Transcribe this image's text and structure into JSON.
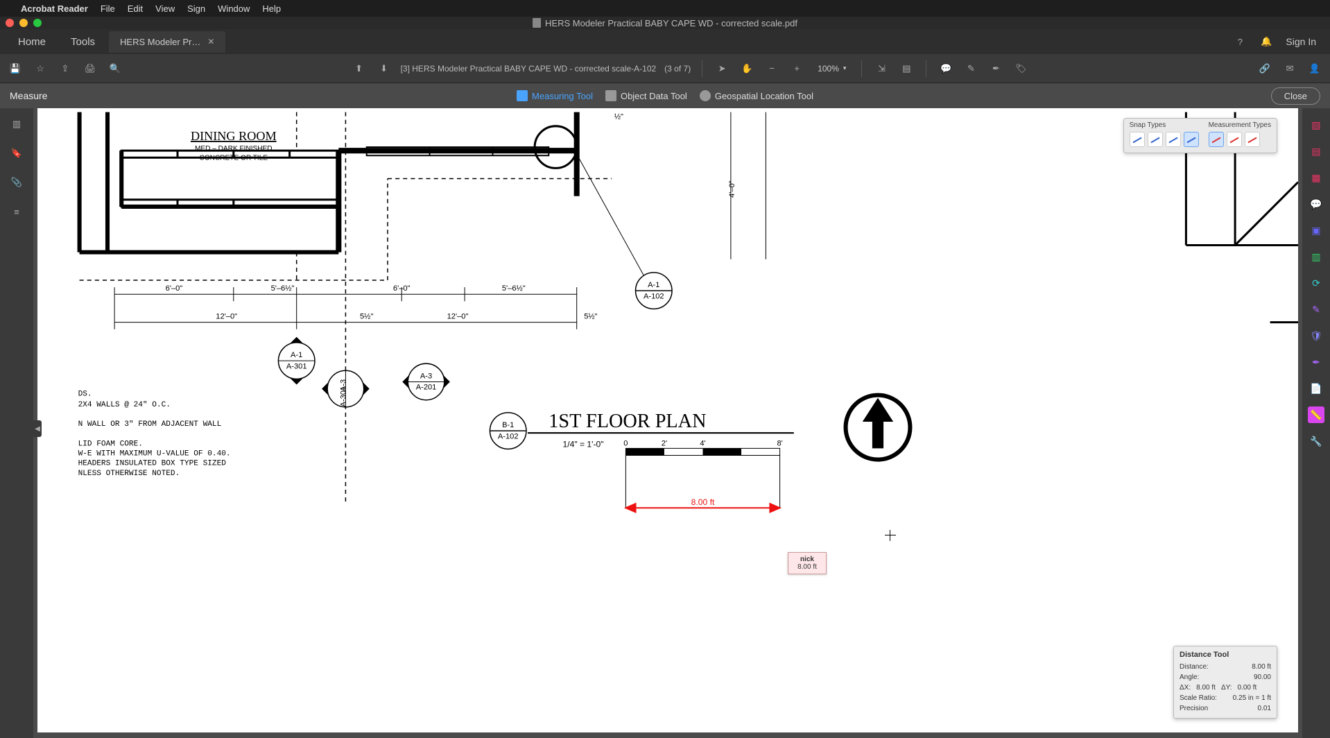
{
  "menubar": {
    "apple": "",
    "app": "Acrobat Reader",
    "items": [
      "File",
      "Edit",
      "View",
      "Sign",
      "Window",
      "Help"
    ]
  },
  "window": {
    "title": "HERS Modeler Practical BABY CAPE WD - corrected scale.pdf"
  },
  "tabs": {
    "home": "Home",
    "tools": "Tools",
    "doc": "HERS Modeler Pr…"
  },
  "tabbar_right": {
    "signin": "Sign In"
  },
  "toolbar": {
    "page_label": "[3] HERS Modeler Practical BABY CAPE WD - corrected scale-A-102",
    "page_of": "(3 of 7)",
    "zoom": "100%"
  },
  "subtoolbar": {
    "label": "Measure",
    "measuring": "Measuring Tool",
    "object": "Object Data Tool",
    "geo": "Geospatial Location Tool",
    "close": "Close"
  },
  "palette": {
    "snap": "Snap Types",
    "meas": "Measurement Types"
  },
  "distance_panel": {
    "title": "Distance Tool",
    "rows": {
      "distance_k": "Distance:",
      "distance_v": "8.00 ft",
      "angle_k": "Angle:",
      "angle_v": "90.00",
      "dx_k": "ΔX:",
      "dx_v": "8.00 ft",
      "dy_k": "ΔY:",
      "dy_v": "0.00 ft",
      "scale_k": "Scale Ratio:",
      "scale_v": "0.25 in = 1 ft",
      "prec_k": "Precision",
      "prec_v": "0.01"
    }
  },
  "measurement": {
    "value": "8.00 ft",
    "label_author": "nick",
    "label_value": "8.00 ft"
  },
  "drawing": {
    "room": "DINING ROOM",
    "room_sub1": "MED.– DARK FINISHED",
    "room_sub2": "CONCRETE OR TILE",
    "dims": {
      "d1": "6'–0\"",
      "d2": "5'–6½\"",
      "d3": "6'–0\"",
      "d4": "5'–6½\"",
      "d5": "12'–0\"",
      "d6": "5½\"",
      "d7": "12'–0\"",
      "d8": "5½\"",
      "d9": "4'–0\"",
      "d10": "½\""
    },
    "callouts": {
      "a1_102_top": "A-1",
      "a1_102_bot": "A-102",
      "a1_301_top": "A-1",
      "a1_301_bot": "A-301",
      "a3_301_top": "A-3",
      "a3_301_bot": "A-301",
      "a3_201_top": "A-3",
      "a3_201_bot": "A-201",
      "b1_102_top": "B-1",
      "b1_102_bot": "A-102"
    },
    "plan_title": "1ST FLOOR PLAN",
    "plan_scale": "1/4\" = 1'-0\"",
    "scalebar": {
      "t0": "0",
      "t2": "2'",
      "t4": "4'",
      "t8": "8'"
    },
    "notes": {
      "n0": "DS.",
      "n1": "2X4 WALLS @ 24\" O.C.",
      "n2": "N WALL OR 3\" FROM ADJACENT WALL",
      "n3": "LID FOAM CORE.",
      "n4": "W-E WITH MAXIMUM U-VALUE OF 0.40.",
      "n5": "HEADERS INSULATED BOX TYPE SIZED",
      "n6": "NLESS OTHERWISE NOTED."
    }
  }
}
